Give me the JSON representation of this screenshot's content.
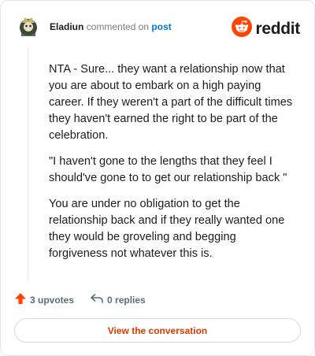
{
  "header": {
    "author": "Eladiun",
    "commented_text": "commented on",
    "post_link": "post",
    "brand": "reddit",
    "icons": [
      "avatar-image",
      "reddit-logo-icon"
    ]
  },
  "comment": {
    "paragraphs": [
      "NTA - Sure... they want a relationship now that you are about to embark on a high paying career. If they weren't a part of the difficult times they haven't earned the right to be part of the celebration.",
      "\"I haven't gone to the lengths that they feel I should've gone to to get our relationship back \"",
      "You are under no obligation to get the relationship back and if they really wanted one they would be groveling and begging forgiveness not whatever this is."
    ]
  },
  "stats": {
    "upvotes": "3 upvotes",
    "replies": "0 replies",
    "icons": [
      "upvote-arrow-icon",
      "reply-arrow-icon"
    ]
  },
  "cta": {
    "label": "View the conversation"
  },
  "colors": {
    "brand_orange": "#ff4500",
    "link_blue": "#0079d3",
    "cta_text": "#d93a00",
    "muted": "#7c7c7c"
  }
}
